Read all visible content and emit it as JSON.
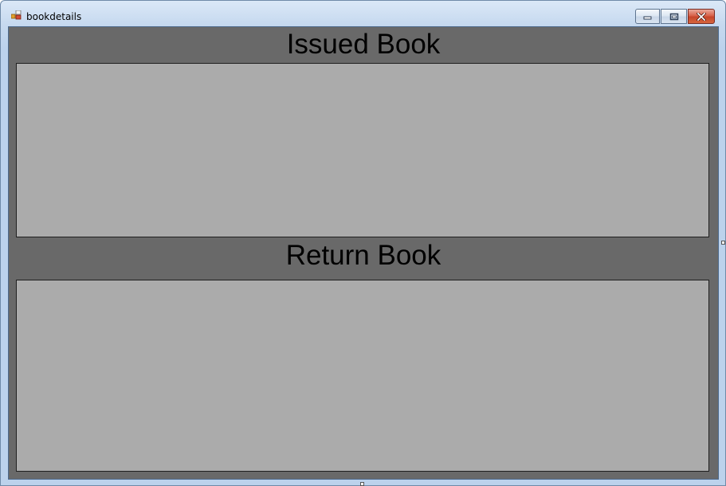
{
  "window": {
    "title": "bookdetails",
    "icon": "winforms-app-icon",
    "controls": {
      "minimize": "minimize-icon",
      "maximize": "maximize-icon",
      "close": "close-icon"
    }
  },
  "form": {
    "background_color": "#696969",
    "issued": {
      "title": "Issued Book",
      "grid_color": "#ababab"
    },
    "returned": {
      "title": "Return Book",
      "grid_color": "#ababab"
    }
  }
}
